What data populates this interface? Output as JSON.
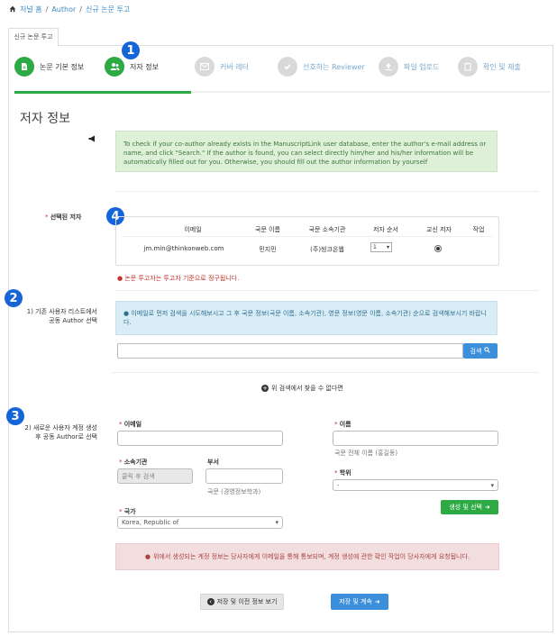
{
  "breadcrumb": {
    "home": "저널 홈",
    "sep": "/",
    "author": "Author",
    "current": "신규 논문 투고"
  },
  "tab": {
    "label": "신규 논문 투고"
  },
  "steps": [
    {
      "label": "논문 기본 정보",
      "state": "done"
    },
    {
      "label": "저자 정보",
      "state": "active"
    },
    {
      "label": "커버 레터",
      "state": "pending"
    },
    {
      "label": "선호하는 Reviewer",
      "state": "pending"
    },
    {
      "label": "파일 업로드",
      "state": "pending"
    },
    {
      "label": "확인 및 제출",
      "state": "pending"
    }
  ],
  "page_title": "저자 정보",
  "guide_text": "To check if your co-author already exists in the ManuscriptLink user database, enter the author's e-mail address or name, and click \"Search.\" If the author is found, you can select directly him/her and his/her information will be automatically filled out for you. Otherwise, you should fill out the author information by yourself",
  "selected_authors": {
    "label": "선택된 저자",
    "columns": [
      "이메일",
      "국문 이름",
      "국문 소속기관",
      "저자 순서",
      "교신 저자",
      "작업"
    ],
    "rows": [
      {
        "email": "jm.min@thinkonweb.com",
        "name": "민지민",
        "affiliation": "(주)씽크온웹",
        "order": "1",
        "corresponding": true
      }
    ]
  },
  "warn_text": "논문 투고자는 투고자 기준으로 정구됩니다.",
  "badges": {
    "b1": "1",
    "b2": "2",
    "b3": "3",
    "b4": "4"
  },
  "section1": {
    "label": "1) 기존 사용자 리스트에서 공동 Author 선택",
    "info": "이메일로 먼저 검색을 시도해보시고 그 후 국문 정보(국문 이름, 소속기관), 영문 정보(영문 이름, 소속기관) 순으로 검색해보시기 바랍니다.",
    "search_value": "",
    "search_button": "검색"
  },
  "not_found": "위 검색에서 찾을 수 없다면",
  "section2": {
    "label": "2) 새로운 사용자 계정 생성후 공동 Author로 선택",
    "email_label": "이메일",
    "name_label": "이름",
    "name_help": "국문 전체 이름 (홍길동)",
    "affiliation_label": "소속기관",
    "affiliation_value": "클릭 후 검색",
    "dept_label": "부서",
    "dept_help": "국문 (경영정보학과)",
    "degree_label": "학위",
    "degree_value": "-",
    "create_button": "생성 및 선택",
    "country_label": "국가",
    "country_value": "Korea, Republic of"
  },
  "notice": "위에서 생성되는 계정 정보는 당사자에게 이메일을 통해 통보되며, 계정 생성에 관한 확인 작업이 당사자에게 요청됩니다.",
  "buttons": {
    "prev": "저장 및 이전 정보 보기",
    "next": "저장 및 계속"
  },
  "colors": {
    "green": "#2eaa44",
    "blue": "#3c8fdb",
    "badge": "#1565d8"
  }
}
